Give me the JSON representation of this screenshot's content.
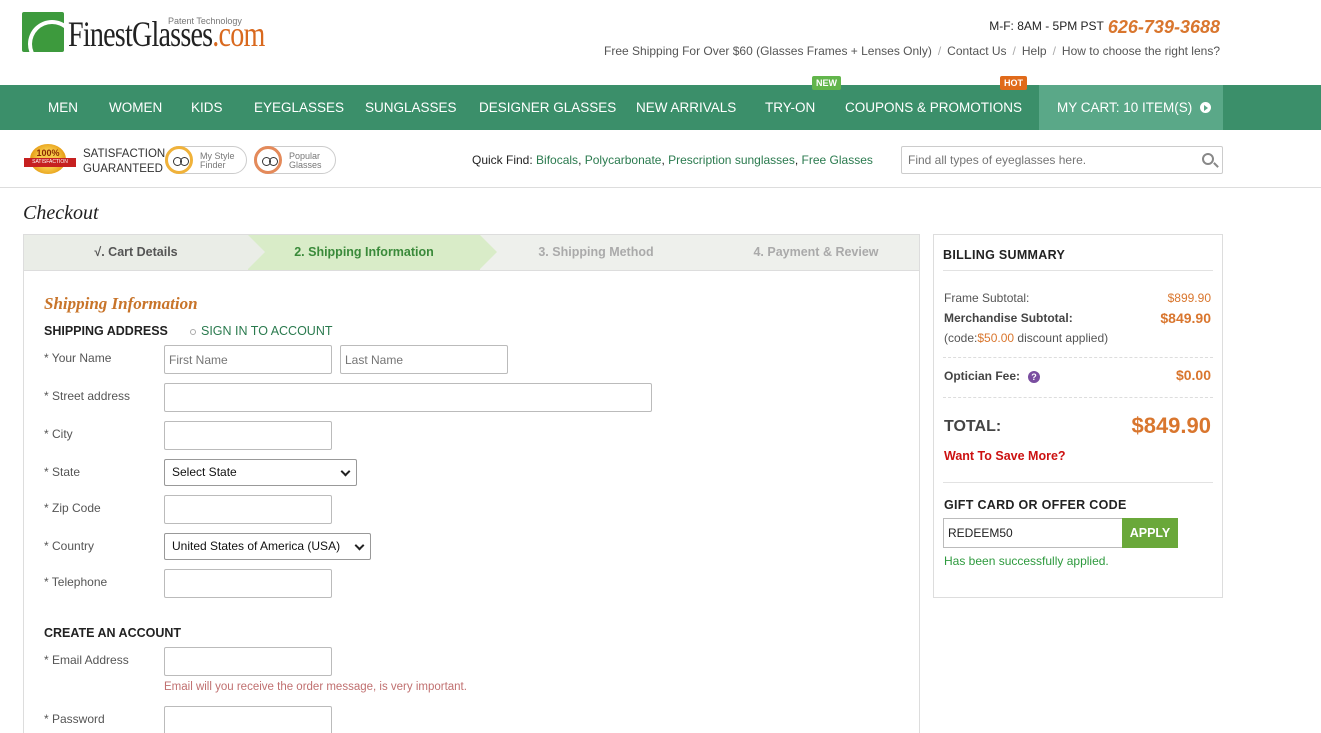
{
  "header": {
    "logo_main": "FinestGlasses",
    "logo_suffix": ".com",
    "logo_patent": "Patent Technology",
    "hours": "M-F: 8AM - 5PM PST",
    "phone": "626-739-3688",
    "free_shipping": "Free Shipping For Over $60 (Glasses Frames + Lenses Only)",
    "contact": "Contact Us",
    "help": "Help",
    "lens_help": "How to choose the right lens?"
  },
  "nav": {
    "items": [
      "MEN",
      "WOMEN",
      "KIDS",
      "EYEGLASSES",
      "SUNGLASSES",
      "DESIGNER GLASSES",
      "NEW ARRIVALS",
      "TRY-ON",
      "COUPONS & PROMOTIONS"
    ],
    "badge_new": "NEW",
    "badge_hot": "HOT",
    "cart": "MY CART: 10 ITEM(S)"
  },
  "subbar": {
    "seal_pct": "100%",
    "seal_ribbon": "SATISFACTION",
    "satisfaction_1": "SATISFACTION",
    "satisfaction_2": "GUARANTEED",
    "style_finder_1": "My Style",
    "style_finder_2": "Finder",
    "popular_1": "Popular",
    "popular_2": "Glasses",
    "quick_find_label": "Quick Find:",
    "quick_links": [
      "Bifocals",
      "Polycarbonate",
      "Prescription sunglasses",
      "Free Glasses"
    ],
    "search_placeholder": "Find all types of eyeglasses here."
  },
  "checkout": {
    "title": "Checkout",
    "steps": [
      "√. Cart Details",
      "2. Shipping Information",
      "3. Shipping Method",
      "4. Payment & Review"
    ],
    "section_title": "Shipping Information",
    "shipping_address": "SHIPPING ADDRESS",
    "sign_in": "SIGN IN TO ACCOUNT",
    "labels": {
      "name": "* Your Name",
      "street": "* Street address",
      "city": "* City",
      "state": "* State",
      "zip": "* Zip Code",
      "country": "* Country",
      "telephone": "* Telephone",
      "email": "* Email Address",
      "password": "* Password"
    },
    "first_name_placeholder": "First Name",
    "last_name_placeholder": "Last Name",
    "state_value": "Select State",
    "country_value": "United States of America (USA)",
    "create_account": "CREATE AN ACCOUNT",
    "email_hint": "Email will you receive the order message, is very important."
  },
  "billing": {
    "title": "BILLING SUMMARY",
    "frame_subtotal_label": "Frame Subtotal:",
    "frame_subtotal": "$899.90",
    "merch_subtotal_label": "Merchandise Subtotal:",
    "merch_subtotal": "$849.90",
    "code_prefix": "(code:",
    "code_amount": "$50.00",
    "code_suffix": " discount applied)",
    "optician_label": "Optician Fee:",
    "optician_fee": "$0.00",
    "total_label": "TOTAL:",
    "total": "$849.90",
    "save_more": "Want To Save More?",
    "gift_title": "GIFT CARD OR OFFER CODE",
    "gift_value": "REDEEM50",
    "apply": "APPLY",
    "applied_msg": "Has been successfully applied."
  },
  "colors": {
    "nav_green": "#3b8f6a",
    "accent_orange": "#d9762e",
    "link_green": "#2a7a4e",
    "alert_red": "#cc1111"
  }
}
